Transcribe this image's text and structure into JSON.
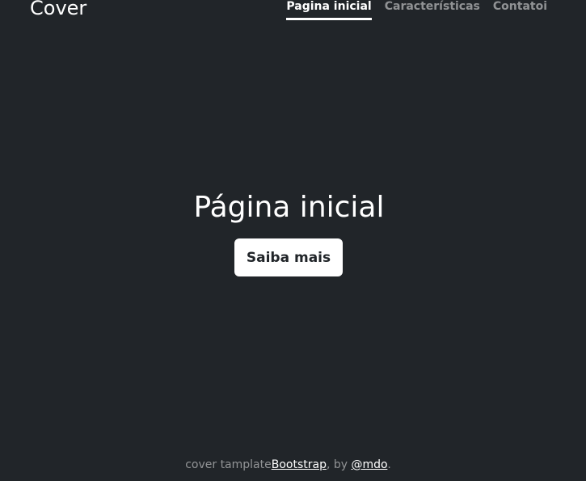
{
  "header": {
    "brand": "Cover",
    "nav": [
      {
        "label": "Pagina inicial",
        "active": true
      },
      {
        "label": "Características",
        "active": false
      },
      {
        "label": "Contatoi",
        "active": false
      }
    ]
  },
  "hero": {
    "title": "Página inicial",
    "button_label": "Saiba mais"
  },
  "footer": {
    "prefix": "cover tamplate",
    "link1": "Bootstrap",
    "middle": ", by ",
    "link2": "@mdo",
    "suffix": "."
  },
  "colors": {
    "background": "#212529",
    "text": "#ffffff",
    "muted": "rgba(255,255,255,0.5)"
  }
}
